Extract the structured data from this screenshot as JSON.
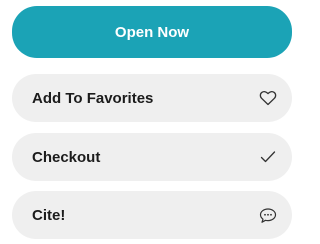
{
  "actions": {
    "open_now_label": "Open Now",
    "favorites_label": "Add To Favorites",
    "checkout_label": "Checkout",
    "cite_label": "Cite!"
  },
  "icons": {
    "favorites": "heart-icon",
    "checkout": "checkmark-icon",
    "cite": "speech-bubble-icon"
  },
  "colors": {
    "primary": "#1ba3b6",
    "secondary_bg": "#efefef",
    "text": "#1c1c1c"
  }
}
